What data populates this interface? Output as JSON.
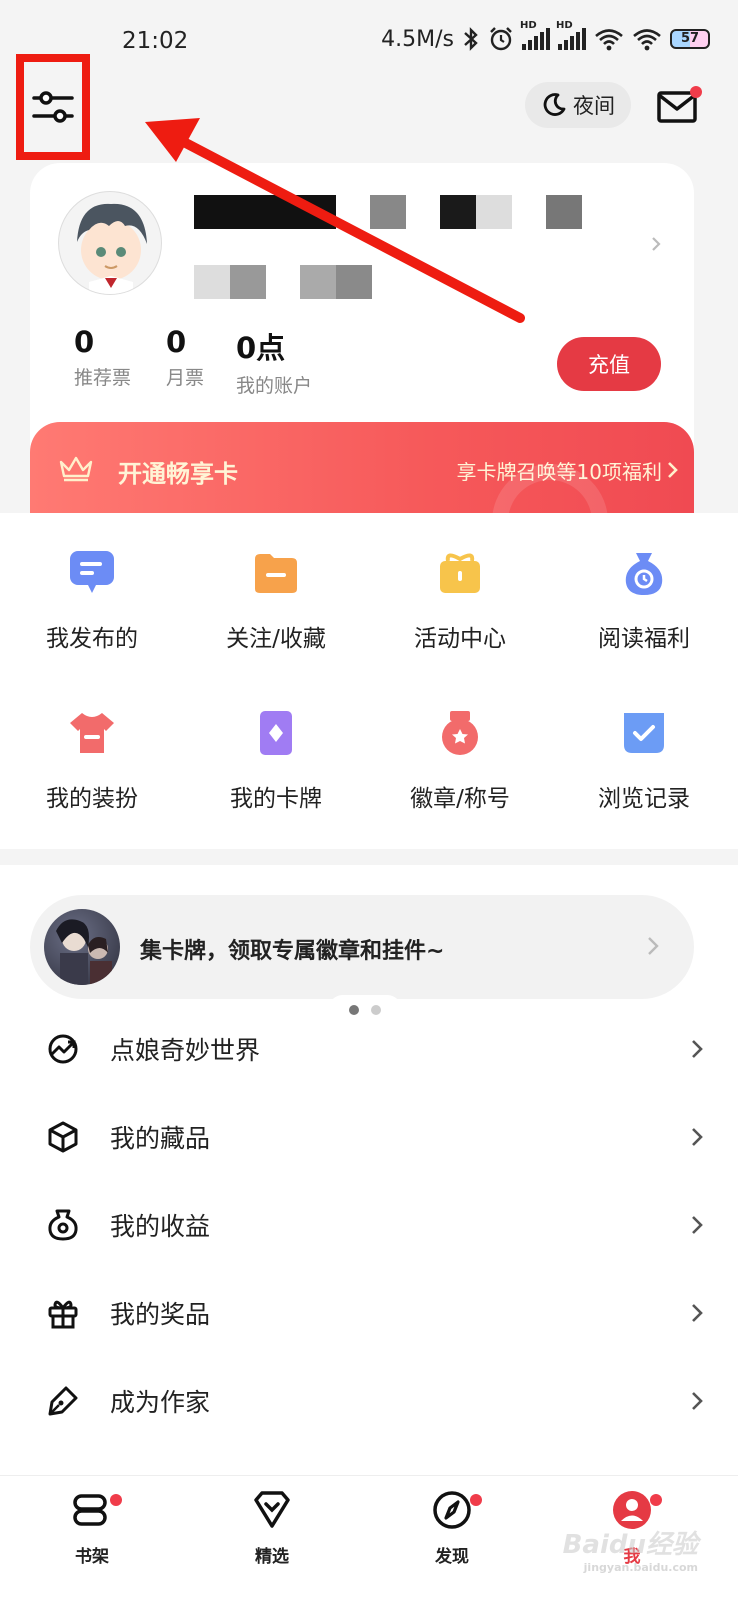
{
  "status_bar": {
    "time": "21:02",
    "speed": "4.5M/s",
    "battery": "57",
    "icons": [
      "bluetooth-icon",
      "alarm-icon",
      "signal-hd-icon",
      "signal-hd-icon",
      "wifi-icon",
      "wifi-icon",
      "battery-icon"
    ]
  },
  "header": {
    "settings_icon": "sliders-icon",
    "night_label": "夜间",
    "mail_icon": "mail-icon"
  },
  "profile": {
    "stats": [
      {
        "value": "0",
        "label": "推荐票"
      },
      {
        "value": "0",
        "label": "月票"
      },
      {
        "value": "0点",
        "label": "我的账户"
      }
    ],
    "recharge_label": "充值"
  },
  "vip": {
    "title": "开通畅享卡",
    "link": "享卡牌召唤等10项福利"
  },
  "grid": [
    {
      "label": "我发布的",
      "icon": "message-icon",
      "color": "#6c8cf5"
    },
    {
      "label": "关注/收藏",
      "icon": "folder-icon",
      "color": "#f7a24b"
    },
    {
      "label": "活动中心",
      "icon": "gift-icon",
      "color": "#f7c44b"
    },
    {
      "label": "阅读福利",
      "icon": "clock-bag-icon",
      "color": "#6c8cf5"
    },
    {
      "label": "我的装扮",
      "icon": "shirt-icon",
      "color": "#f26b6b"
    },
    {
      "label": "我的卡牌",
      "icon": "card-icon",
      "color": "#a07cf3"
    },
    {
      "label": "徽章/称号",
      "icon": "medal-icon",
      "color": "#f26b6b"
    },
    {
      "label": "浏览记录",
      "icon": "history-icon",
      "color": "#6c9cf5"
    }
  ],
  "promo": {
    "text": "集卡牌，领取专属徽章和挂件~"
  },
  "menu": [
    {
      "label": "点娘奇妙世界",
      "icon": "world-icon"
    },
    {
      "label": "我的藏品",
      "icon": "cube-icon"
    },
    {
      "label": "我的收益",
      "icon": "earnings-icon"
    },
    {
      "label": "我的奖品",
      "icon": "gift-box-icon"
    },
    {
      "label": "成为作家",
      "icon": "pen-icon"
    }
  ],
  "bottom_nav": [
    {
      "label": "书架",
      "icon": "bookshelf-icon"
    },
    {
      "label": "精选",
      "icon": "diamond-icon"
    },
    {
      "label": "发现",
      "icon": "compass-icon"
    },
    {
      "label": "我",
      "icon": "profile-icon"
    }
  ],
  "colors": {
    "accent": "#e53a44",
    "annotation": "#ee1c11"
  }
}
